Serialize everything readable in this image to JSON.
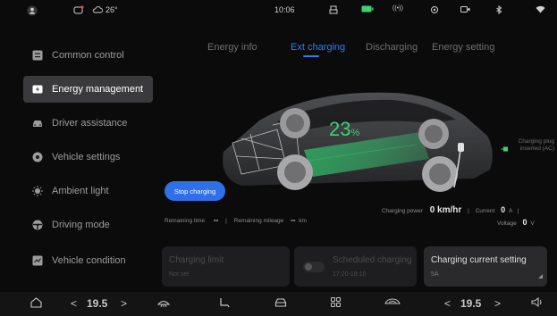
{
  "status_bar": {
    "temperature": "26°",
    "time": "10:06"
  },
  "sidebar": {
    "items": [
      {
        "label": "Common control",
        "icon": "grid-icon"
      },
      {
        "label": "Energy management",
        "icon": "battery-icon",
        "active": true
      },
      {
        "label": "Driver assistance",
        "icon": "car-front-icon"
      },
      {
        "label": "Vehicle settings",
        "icon": "settings-icon"
      },
      {
        "label": "Ambient light",
        "icon": "light-icon"
      },
      {
        "label": "Driving mode",
        "icon": "steering-icon"
      },
      {
        "label": "Vehicle condition",
        "icon": "gauge-icon"
      }
    ]
  },
  "tabs": [
    {
      "label": "Energy info"
    },
    {
      "label": "Ext charging",
      "active": true
    },
    {
      "label": "Discharging"
    },
    {
      "label": "Energy setting"
    }
  ],
  "charging": {
    "battery_percent": "23",
    "percent_sign": "%",
    "stop_button": "Stop charging",
    "plug_label": "Charging plug inserted (AC)",
    "remaining_time_label": "Remaining time",
    "remaining_time_value": "--",
    "remaining_mileage_label": "Remaining mileage",
    "remaining_mileage_value": "--",
    "remaining_mileage_unit": "km",
    "charging_power_label": "Charging power",
    "charging_power_value": "0 km/hr",
    "current_label": "Current",
    "current_value": "0",
    "current_unit": "A",
    "voltage_label": "Voltage",
    "voltage_value": "0",
    "voltage_unit": "V",
    "sep": "|"
  },
  "cards": [
    {
      "title": "Charging limit",
      "sub": "Not set"
    },
    {
      "title": "Scheduled charging",
      "sub": "17:20-18:10"
    },
    {
      "title": "Charging current setting",
      "sub": "5A"
    }
  ],
  "bottom_bar": {
    "left_temp": "19.5",
    "right_temp": "19.5",
    "arrow_left": "<",
    "arrow_right": ">"
  },
  "colors": {
    "accent": "#2f7bf5",
    "battery_green": "#3fd07a"
  }
}
